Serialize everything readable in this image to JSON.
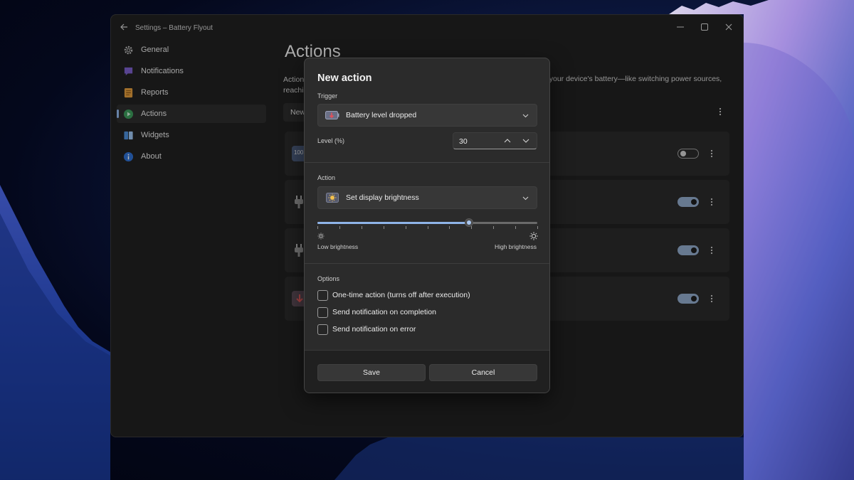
{
  "window": {
    "title": "Settings – Battery Flyout",
    "controls": {
      "minimize": "minimize-icon",
      "maximize": "maximize-icon",
      "close": "close-icon"
    }
  },
  "sidebar": {
    "items": [
      {
        "label": "General",
        "icon": "gear-icon"
      },
      {
        "label": "Notifications",
        "icon": "chat-bubble-icon"
      },
      {
        "label": "Reports",
        "icon": "document-icon"
      },
      {
        "label": "Actions",
        "icon": "play-icon",
        "active": true
      },
      {
        "label": "Widgets",
        "icon": "widgets-icon"
      },
      {
        "label": "About",
        "icon": "info-icon"
      }
    ]
  },
  "main": {
    "title": "Actions",
    "description_line1": "Action",
    "description_line2": "reachi",
    "description_right": "h your device's battery—like switching power sources,",
    "new_button": "New",
    "cards": [
      {
        "icon": "battery-level-icon",
        "icon_text": "100",
        "enabled": false
      },
      {
        "icon": "plug-icon",
        "enabled": true
      },
      {
        "icon": "plug-icon",
        "enabled": true
      },
      {
        "icon": "battery-drop-icon",
        "enabled": true
      }
    ]
  },
  "dialog": {
    "title": "New action",
    "trigger": {
      "label": "Trigger",
      "selected": "Battery level dropped",
      "icon": "battery-down-icon"
    },
    "level": {
      "label": "Level (%)",
      "value": "30"
    },
    "action": {
      "label": "Action",
      "selected": "Set display brightness",
      "icon": "brightness-icon"
    },
    "slider": {
      "value_fraction": 0.69,
      "tick_count": 11,
      "low_label": "Low brightness",
      "high_label": "High brightness"
    },
    "options": {
      "label": "Options",
      "items": [
        {
          "label": "One-time action (turns off after execution)",
          "checked": false
        },
        {
          "label": "Send notification on completion",
          "checked": false
        },
        {
          "label": "Send notification on error",
          "checked": false
        }
      ]
    },
    "buttons": {
      "save": "Save",
      "cancel": "Cancel"
    }
  },
  "colors": {
    "accent": "#8fb4e8",
    "toggle_on": "#8fa8c8",
    "window_bg": "#202020",
    "dialog_bg": "#2b2b2b"
  }
}
